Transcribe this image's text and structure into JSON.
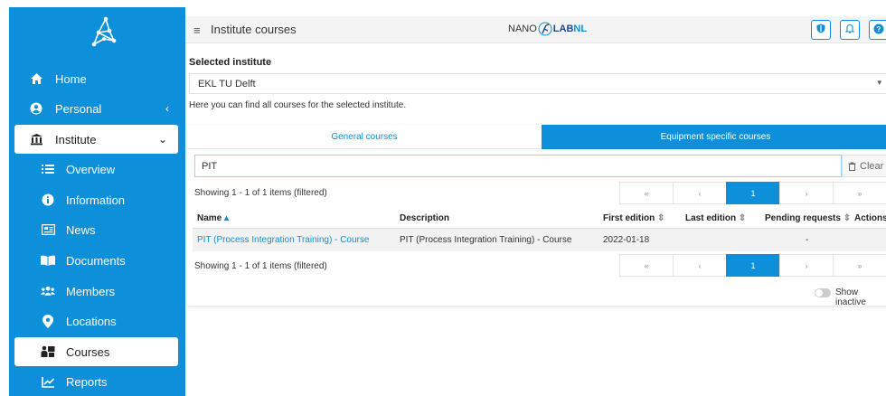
{
  "sidebar": {
    "items": [
      {
        "label": "Home",
        "icon": "home-icon"
      },
      {
        "label": "Personal",
        "icon": "user-circle-icon",
        "chevron": "‹"
      },
      {
        "label": "Institute",
        "icon": "institution-icon",
        "chevron": "⌄"
      },
      {
        "label": "Overview",
        "icon": "list-icon"
      },
      {
        "label": "Information",
        "icon": "info-icon"
      },
      {
        "label": "News",
        "icon": "newspaper-icon"
      },
      {
        "label": "Documents",
        "icon": "book-open-icon"
      },
      {
        "label": "Members",
        "icon": "users-icon"
      },
      {
        "label": "Locations",
        "icon": "map-marker-icon"
      },
      {
        "label": "Courses",
        "icon": "teacher-icon"
      },
      {
        "label": "Reports",
        "icon": "chart-line-icon"
      }
    ]
  },
  "header": {
    "menu_glyph": "≡",
    "title": "Institute courses",
    "brand_nano": "NANO",
    "brand_lab": "LAB",
    "brand_nl": "NL",
    "buttons": [
      "shield-icon",
      "bell-icon",
      "help-icon"
    ]
  },
  "institute": {
    "label": "Selected institute",
    "value": "EKL TU Delft",
    "caret": "▾",
    "description": "Here you can find all courses for the selected institute."
  },
  "tabs": [
    {
      "label": "General courses",
      "active": false
    },
    {
      "label": "Equipment specific courses",
      "active": true
    }
  ],
  "search": {
    "value": "PIT",
    "clear_label": "Clear"
  },
  "showing_top": "Showing 1 - 1 of 1 items (filtered)",
  "showing_bottom": "Showing 1 - 1 of 1 items (filtered)",
  "pager": {
    "first": "«",
    "prev": "‹",
    "current": "1",
    "next": "›",
    "last": "»"
  },
  "table": {
    "columns": [
      {
        "label": "Name",
        "sort": "▴"
      },
      {
        "label": "Description",
        "sort": ""
      },
      {
        "label": "First edition",
        "sort": "⇕"
      },
      {
        "label": "Last edition",
        "sort": "⇕"
      },
      {
        "label": "Pending requests",
        "sort": "⇕"
      },
      {
        "label": "Actions",
        "sort": ""
      }
    ],
    "rows": [
      {
        "name": "PIT (Process Integration Training) - Course",
        "description": "PIT (Process Integration Training) - Course",
        "first_edition": "2022-01-18",
        "last_edition": "",
        "pending_requests": "-"
      }
    ]
  },
  "show_inactive_label": "Show inactive",
  "colors": {
    "accent": "#0d8fd9",
    "brand_dark": "#1b4a8a"
  }
}
